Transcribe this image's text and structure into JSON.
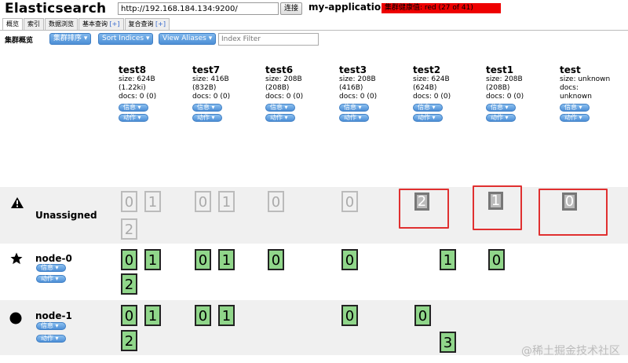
{
  "header": {
    "title": "Elasticsearch",
    "url_value": "http://192.168.184.134:9200/",
    "connect_label": "连接",
    "cluster_name": "my-application",
    "health_text": "集群健康值: red (27 of 41)",
    "health_color": "#ee0000"
  },
  "tabs": [
    {
      "label": "概览"
    },
    {
      "label": "索引"
    },
    {
      "label": "数据浏览"
    },
    {
      "label": "基本查询",
      "plus": "[+]"
    },
    {
      "label": "复合查询",
      "plus": "[+]"
    }
  ],
  "toolbar": {
    "label": "集群概览",
    "sort_cluster": "集群排序",
    "sort_indices": "Sort Indices",
    "view_aliases": "View Aliases",
    "filter_placeholder": "Index Filter"
  },
  "indices": [
    {
      "name": "test8",
      "size": "size: 624B",
      "size2": "(1.22ki)",
      "docs": "docs: 0 (0)",
      "info": "信息",
      "action": "动作"
    },
    {
      "name": "test7",
      "size": "size: 416B",
      "size2": "(832B)",
      "docs": "docs: 0 (0)",
      "info": "信息",
      "action": "动作"
    },
    {
      "name": "test6",
      "size": "size: 208B",
      "size2": "(208B)",
      "docs": "docs: 0 (0)",
      "info": "信息",
      "action": "动作"
    },
    {
      "name": "test3",
      "size": "size: 208B",
      "size2": "(416B)",
      "docs": "docs: 0 (0)",
      "info": "信息",
      "action": "动作"
    },
    {
      "name": "test2",
      "size": "size: 624B",
      "size2": "(624B)",
      "docs": "docs: 0 (0)",
      "info": "信息",
      "action": "动作"
    },
    {
      "name": "test1",
      "size": "size: 208B",
      "size2": "(208B)",
      "docs": "docs: 0 (0)",
      "info": "信息",
      "action": "动作"
    },
    {
      "name": "test",
      "size": "size: unknown",
      "size2": "docs:",
      "docs": "unknown",
      "info": "信息",
      "action": "动作"
    }
  ],
  "rows": {
    "unassigned": {
      "label": "Unassigned",
      "icon": "warning-icon"
    },
    "node0": {
      "label": "node-0",
      "icon": "star-icon",
      "info": "信息",
      "action": "动作"
    },
    "node1": {
      "label": "node-1",
      "icon": "circle-icon",
      "info": "信息",
      "action": "动作"
    }
  },
  "shards": {
    "u_test8_0": "0",
    "u_test8_1": "1",
    "u_test8_2": "2",
    "u_test7_0": "0",
    "u_test7_1": "1",
    "u_test6_0": "0",
    "u_test3_0": "0",
    "u_test2_2": "2",
    "u_test1_1": "1",
    "u_test_0": "0",
    "n0_test8_0": "0",
    "n0_test8_1": "1",
    "n0_test8_2": "2",
    "n0_test7_0": "0",
    "n0_test7_1": "1",
    "n0_test6_0": "0",
    "n0_test3_0": "0",
    "n0_test2_1": "1",
    "n0_test1_0": "0",
    "n1_test8_0": "0",
    "n1_test8_1": "1",
    "n1_test8_2": "2",
    "n1_test7_0": "0",
    "n1_test7_1": "1",
    "n1_test3_0": "0",
    "n1_test2_0": "0",
    "n1_test2_3": "3"
  },
  "watermark": "@稀土掘金技术社区"
}
